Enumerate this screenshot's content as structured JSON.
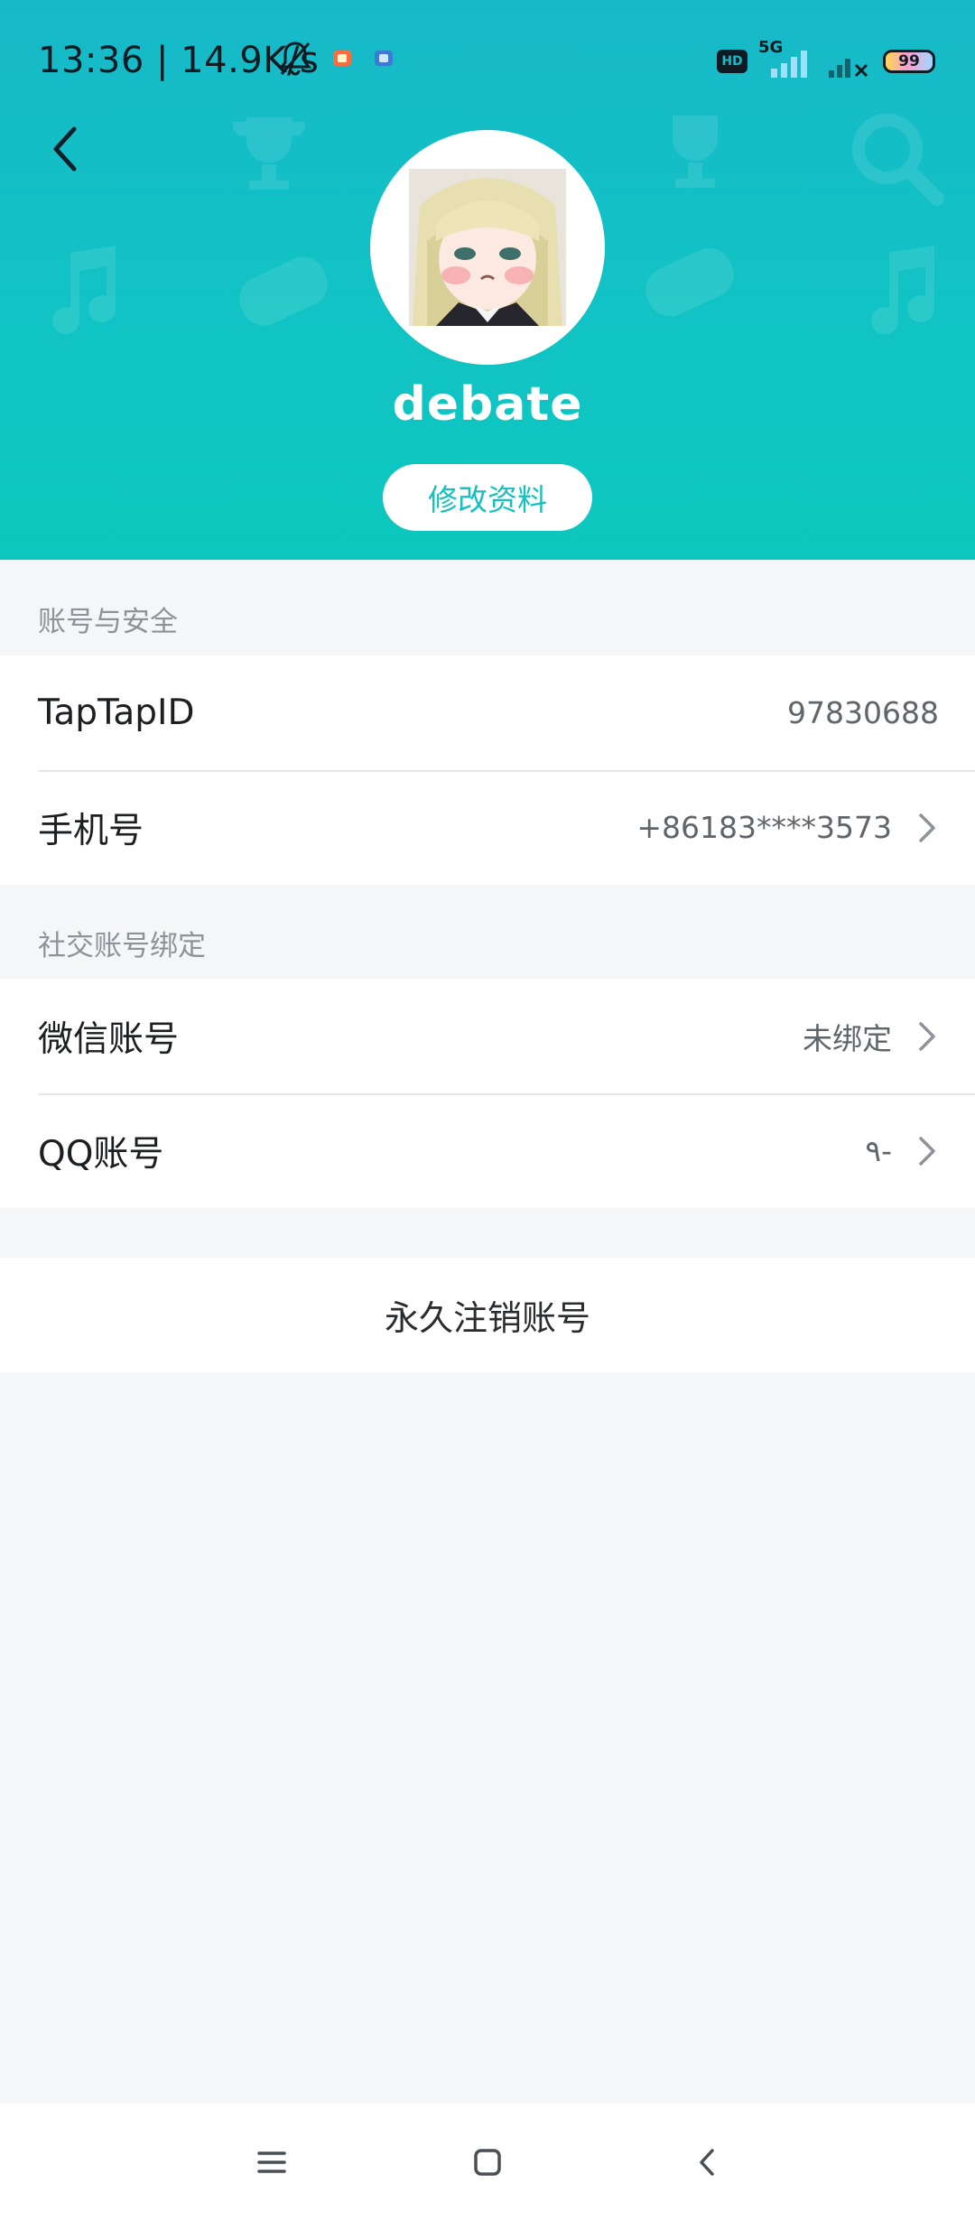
{
  "status_bar": {
    "time": "13:36 | 14.9K/s",
    "network": "5G",
    "hd": "HD",
    "battery": "99",
    "icons": [
      "mute-bell-icon",
      "app-notification-icon",
      "app-notification-icon",
      "signal-icon",
      "signal-no-service-icon",
      "battery-icon"
    ]
  },
  "header": {
    "back_icon": "chevron-left-icon",
    "username": "debate",
    "edit_profile_label": "修改资料",
    "gradient_top": "#17b9c8",
    "gradient_bottom": "#0cc7bd"
  },
  "account_security": {
    "section_title": "账号与安全",
    "rows": [
      {
        "label": "TapTapID",
        "value": "97830688",
        "has_chevron": false
      },
      {
        "label": "手机号",
        "value": "+86183****3573",
        "has_chevron": true
      }
    ]
  },
  "social_binding": {
    "section_title": "社交账号绑定",
    "rows": [
      {
        "label": "微信账号",
        "value": "未绑定",
        "has_chevron": true
      },
      {
        "label": "QQ账号",
        "value": "٩-",
        "has_chevron": true
      }
    ]
  },
  "delete_account_label": "永久注销账号",
  "nav_bar": {
    "icons": [
      "menu-icon",
      "home-square-icon",
      "back-triangle-icon"
    ]
  },
  "colors": {
    "accent": "#15c0c0",
    "page_bg": "#f5f6f8"
  }
}
